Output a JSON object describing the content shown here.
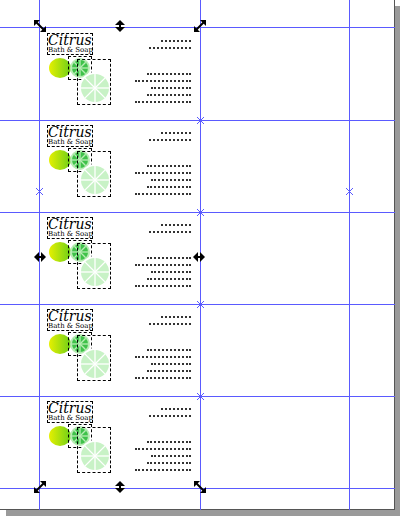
{
  "document": {
    "cards": [
      {
        "title": "Citrus",
        "subtitle": "Bath & Soap"
      },
      {
        "title": "Citrus",
        "subtitle": "Bath & Soap"
      },
      {
        "title": "Citrus",
        "subtitle": "Bath & Soap"
      },
      {
        "title": "Citrus",
        "subtitle": "Bath & Soap"
      },
      {
        "title": "Citrus",
        "subtitle": "Bath & Soap"
      }
    ]
  },
  "selection": {
    "selected": true
  }
}
